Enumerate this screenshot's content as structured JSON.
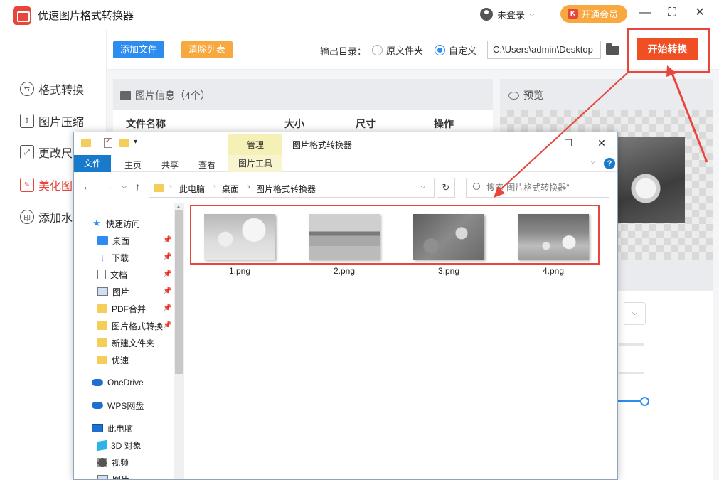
{
  "app": {
    "title": "优速图片格式转换器",
    "user_label": "未登录",
    "vip_label": "开通会员",
    "vip_icon": "K"
  },
  "sidebar": {
    "items": [
      {
        "label": "格式转换",
        "icon": "format-convert-icon"
      },
      {
        "label": "图片压缩",
        "icon": "compress-icon"
      },
      {
        "label": "更改尺寸",
        "icon": "resize-icon"
      },
      {
        "label": "美化图片",
        "icon": "beautify-icon",
        "active": true
      },
      {
        "label": "添加水印",
        "icon": "watermark-icon"
      }
    ]
  },
  "toolbar": {
    "add_label": "添加文件",
    "clear_label": "清除列表",
    "output_label": "输出目录：",
    "radio_original": "原文件夹",
    "radio_custom": "自定义",
    "output_path": "C:\\Users\\admin\\Desktop",
    "start_label": "开始转换"
  },
  "file_panel": {
    "title": "图片信息（4个）",
    "columns": [
      "文件名称",
      "大小",
      "尺寸",
      "操作"
    ]
  },
  "preview": {
    "title": "预览"
  },
  "explorer": {
    "manage_tab": "管理",
    "window_title": "图片格式转换器",
    "ribbon": {
      "file": "文件",
      "home": "主页",
      "share": "共享",
      "view": "查看",
      "picture_tools": "图片工具"
    },
    "breadcrumb": [
      "此电脑",
      "桌面",
      "图片格式转换器"
    ],
    "search_placeholder": "搜索\"图片格式转换器\"",
    "nav": [
      {
        "label": "快速访问",
        "icon": "star-icon"
      },
      {
        "label": "桌面",
        "icon": "desktop-icon",
        "pinned": true
      },
      {
        "label": "下载",
        "icon": "download-icon",
        "pinned": true
      },
      {
        "label": "文档",
        "icon": "document-icon",
        "pinned": true
      },
      {
        "label": "图片",
        "icon": "picture-icon",
        "pinned": true
      },
      {
        "label": "PDF合并",
        "icon": "folder-icon",
        "pinned": true
      },
      {
        "label": "图片格式转换",
        "icon": "folder-icon",
        "pinned": true
      },
      {
        "label": "新建文件夹",
        "icon": "folder-icon"
      },
      {
        "label": "优速",
        "icon": "folder-icon"
      },
      {
        "label": "OneDrive",
        "icon": "onedrive-icon"
      },
      {
        "label": "WPS网盘",
        "icon": "wps-cloud-icon"
      },
      {
        "label": "此电脑",
        "icon": "computer-icon"
      },
      {
        "label": "3D 对象",
        "icon": "3d-objects-icon"
      },
      {
        "label": "视频",
        "icon": "video-icon"
      },
      {
        "label": "图片",
        "icon": "picture-icon"
      }
    ],
    "files": [
      {
        "name": "1.png"
      },
      {
        "name": "2.png"
      },
      {
        "name": "3.png"
      },
      {
        "name": "4.png"
      }
    ]
  },
  "colors": {
    "accent_red": "#e8453c",
    "start_button": "#f04e23",
    "primary_blue": "#2d8cf0",
    "orange": "#f7a940"
  }
}
